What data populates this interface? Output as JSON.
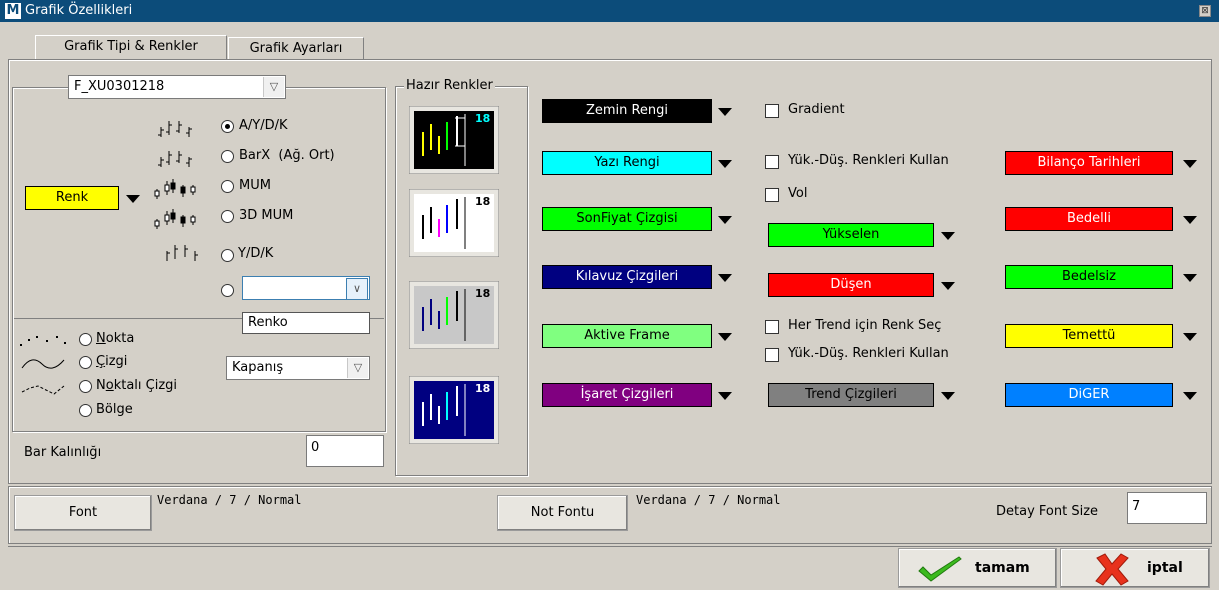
{
  "window": {
    "title": "Grafik Özellikleri",
    "logo": "M"
  },
  "tabs": [
    {
      "label": "Grafik Tipi & Renkler"
    },
    {
      "label": "Grafik Ayarları"
    }
  ],
  "symbol": {
    "value": "F_XU0301218"
  },
  "color_button": {
    "label": "Renk",
    "color": "#ffff00"
  },
  "chart_types": [
    {
      "label": "A/Y/D/K",
      "selected": true
    },
    {
      "label": "BarX  (Ağ. Ort)",
      "selected": false
    },
    {
      "label": "MUM",
      "selected": false
    },
    {
      "label": "3D MUM",
      "selected": false
    },
    {
      "label": "Y/D/K",
      "selected": false
    }
  ],
  "extra_type": {
    "value": "",
    "dropdown_item": "Renko"
  },
  "line_types": [
    {
      "label": "Nokta",
      "underline": "N",
      "rest": "okta"
    },
    {
      "label": "Çizgi",
      "underline": "Ç",
      "rest": "izgi"
    },
    {
      "label": "Noktalı Çizgi",
      "pre": "N",
      "underline": "o",
      "rest": "ktalı Çizgi"
    },
    {
      "label": "Bölge"
    }
  ],
  "line_source": {
    "value": "Kapanış"
  },
  "bar_thickness": {
    "label": "Bar Kalınlığı",
    "value": "0"
  },
  "presets": {
    "label": "Hazır Renkler",
    "number": "18"
  },
  "color_buttons_left": [
    {
      "label": "Zemin Rengi",
      "bg": "#000000",
      "fg": "#ffffff"
    },
    {
      "label": "Yazı Rengi",
      "bg": "#00ffff",
      "fg": "#000000"
    },
    {
      "label": "SonFiyat Çizgisi",
      "bg": "#00ff00",
      "fg": "#000000"
    },
    {
      "label": "Kılavuz Çizgileri",
      "bg": "#000080",
      "fg": "#ffffff"
    },
    {
      "label": "Aktive Frame",
      "bg": "#80ff80",
      "fg": "#000000"
    },
    {
      "label": "İşaret Çizgileri",
      "bg": "#800080",
      "fg": "#ffffff"
    }
  ],
  "checkboxes": {
    "gradient": "Gradient",
    "yuk_dus_1": "Yük.-Düş. Renkleri Kullan",
    "vol": "Vol",
    "her_trend": "Her Trend için Renk Seç",
    "yuk_dus_2": "Yük.-Düş. Renkleri Kullan"
  },
  "color_buttons_mid": [
    {
      "label": "Yükselen",
      "bg": "#00ff00",
      "fg": "#000000"
    },
    {
      "label": "Düşen",
      "bg": "#ff0000",
      "fg": "#ffffff"
    },
    {
      "label": "Trend Çizgileri",
      "bg": "#808080",
      "fg": "#000000"
    }
  ],
  "color_buttons_right": [
    {
      "label": "Bilanço Tarihleri",
      "bg": "#ff0000",
      "fg": "#ffffff"
    },
    {
      "label": "Bedelli",
      "bg": "#ff0000",
      "fg": "#ffffff"
    },
    {
      "label": "Bedelsiz",
      "bg": "#00ff00",
      "fg": "#000000"
    },
    {
      "label": "Temettü",
      "bg": "#ffff00",
      "fg": "#000000"
    },
    {
      "label": "DiGER",
      "bg": "#0080ff",
      "fg": "#ffffff"
    }
  ],
  "font": {
    "button": "Font",
    "info": "Verdana / 7 / Normal"
  },
  "note_font": {
    "button": "Not Fontu",
    "info": "Verdana / 7 / Normal"
  },
  "detail_font": {
    "label": "Detay Font Size",
    "value": "7"
  },
  "actions": {
    "ok": "tamam",
    "cancel": "iptal"
  }
}
